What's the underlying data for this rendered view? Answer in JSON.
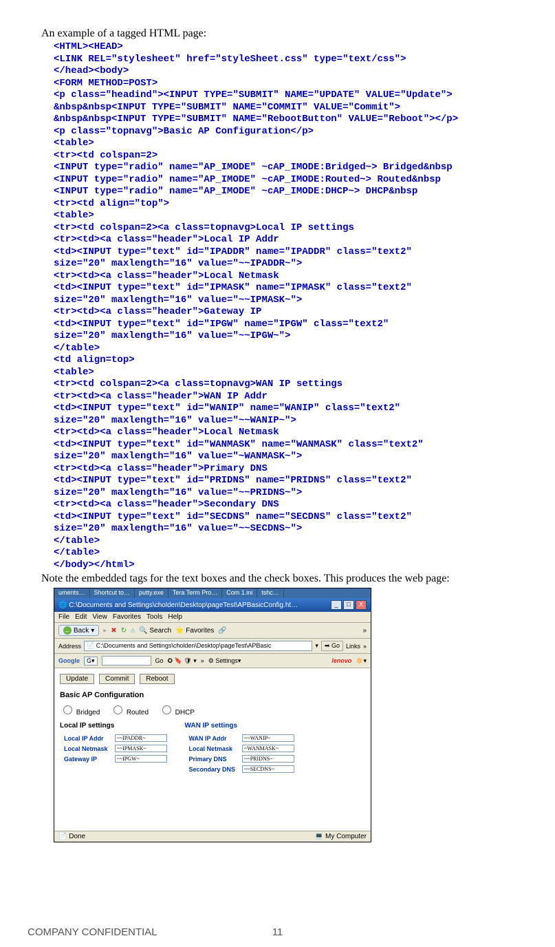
{
  "intro_text": "An example of a tagged HTML page:",
  "code_lines": [
    "<HTML><HEAD>",
    "<LINK REL=\"stylesheet\" href=\"styleSheet.css\" type=\"text/css\">",
    "</head><body>",
    "<FORM METHOD=POST>",
    "<p class=\"headind\"><INPUT TYPE=\"SUBMIT\" NAME=\"UPDATE\" VALUE=\"Update\">",
    "&nbsp&nbsp<INPUT TYPE=\"SUBMIT\" NAME=\"COMMIT\" VALUE=\"Commit\">",
    "&nbsp&nbsp<INPUT TYPE=\"SUBMIT\" NAME=\"RebootButton\" VALUE=\"Reboot\"></p>",
    "<p class=\"topnavg\">Basic AP Configuration</p>",
    "<table>",
    "<tr><td colspan=2>",
    "<INPUT type=\"radio\" name=\"AP_IMODE\" ~cAP_IMODE:Bridged~> Bridged&nbsp",
    "<INPUT type=\"radio\" name=\"AP_IMODE\" ~cAP_IMODE:Routed~> Routed&nbsp",
    "<INPUT type=\"radio\" name=\"AP_IMODE\" ~cAP_IMODE:DHCP~> DHCP&nbsp",
    "<tr><td align=\"top\">",
    "<table>",
    "<tr><td colspan=2><a class=topnavg>Local IP settings",
    "<tr><td><a class=\"header\">Local IP Addr",
    "<td><INPUT type=\"text\" id=\"IPADDR\" name=\"IPADDR\" class=\"text2\"",
    "size=\"20\" maxlength=\"16\" value=\"~~IPADDR~\">",
    "<tr><td><a class=\"header\">Local Netmask",
    "<td><INPUT type=\"text\" id=\"IPMASK\" name=\"IPMASK\" class=\"text2\"",
    "size=\"20\" maxlength=\"16\" value=\"~~IPMASK~\">",
    "<tr><td><a class=\"header\">Gateway IP",
    "<td><INPUT type=\"text\" id=\"IPGW\" name=\"IPGW\" class=\"text2\"",
    "size=\"20\" maxlength=\"16\" value=\"~~IPGW~\">",
    "</table>",
    "<td align=top>",
    "<table>",
    "<tr><td colspan=2><a class=topnavg>WAN IP settings",
    "<tr><td><a class=\"header\">WAN IP Addr",
    "<td><INPUT type=\"text\" id=\"WANIP\" name=\"WANIP\" class=\"text2\"",
    "size=\"20\" maxlength=\"16\" value=\"~~WANIP~\">",
    "<tr><td><a class=\"header\">Local Netmask",
    "<td><INPUT type=\"text\" id=\"WANMASK\" name=\"WANMASK\" class=\"text2\"",
    "size=\"20\" maxlength=\"16\" value=\"~WANMASK~\">",
    "<tr><td><a class=\"header\">Primary DNS",
    "<td><INPUT type=\"text\" id=\"PRIDNS\" name=\"PRIDNS\" class=\"text2\"",
    "size=\"20\" maxlength=\"16\" value=\"~~PRIDNS~\">",
    "<tr><td><a class=\"header\">Secondary DNS",
    "<td><INPUT type=\"text\" id=\"SECDNS\" name=\"SECDNS\" class=\"text2\"",
    "size=\"20\" maxlength=\"16\" value=\"~~SECDNS~\">",
    "</table>",
    "</table>",
    "</body></html>"
  ],
  "note_text": "Note the embedded tags for the text boxes and the check boxes. This produces the web page:",
  "screenshot": {
    "topbar_items": [
      "uments…",
      "Shortcut to…",
      "putty.exe",
      "Tera Term Pro…",
      "Com 1.ini",
      "tshc…"
    ],
    "window_title": "C:\\Documents and Settings\\cholden\\Desktop\\pageTest\\APBasicConfig.ht…",
    "menubar": [
      "File",
      "Edit",
      "View",
      "Favorites",
      "Tools",
      "Help"
    ],
    "toolbar_back": "Back",
    "toolbar_search": "Search",
    "toolbar_favorites": "Favorites",
    "addr_label": "Address",
    "addr_value": "C:\\Documents and Settings\\cholden\\Desktop\\pageTest\\APBasic",
    "go_label": "Go",
    "links_label": "Links",
    "google_label": "Google",
    "google_go": "Go",
    "google_settings": "Settings",
    "lenovo": "lenovo",
    "buttons": {
      "update": "Update",
      "commit": "Commit",
      "reboot": "Reboot"
    },
    "page_heading": "Basic AP Configuration",
    "radios": {
      "bridged": "Bridged",
      "routed": "Routed",
      "dhcp": "DHCP"
    },
    "local": {
      "title": "Local IP settings",
      "rows": [
        {
          "label": "Local IP Addr",
          "value": "~~IPADDR~"
        },
        {
          "label": "Local Netmask",
          "value": "~~IPMASK~"
        },
        {
          "label": "Gateway IP",
          "value": "~~IPGW~"
        }
      ]
    },
    "wan": {
      "title": "WAN IP settings",
      "rows": [
        {
          "label": "WAN IP Addr",
          "value": "~~WANIP~"
        },
        {
          "label": "Local Netmask",
          "value": "~WANMASK~"
        },
        {
          "label": "Primary DNS",
          "value": "~~PRIDNS~"
        },
        {
          "label": "Secondary DNS",
          "value": "~~SECDNS~"
        }
      ]
    },
    "status_done": "Done",
    "status_zone": "My Computer"
  },
  "footer": {
    "left": "COMPANY CONFIDENTIAL",
    "page": "11"
  }
}
